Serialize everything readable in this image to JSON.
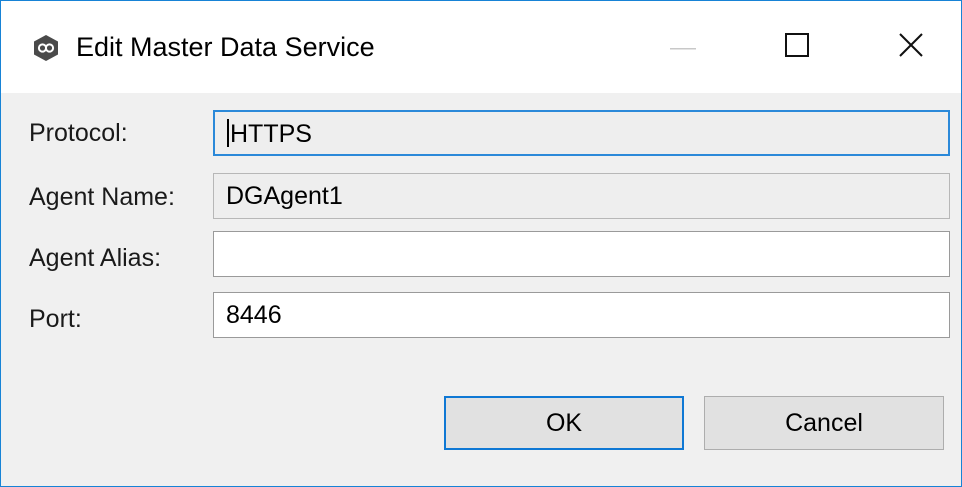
{
  "window": {
    "title": "Edit Master Data Service",
    "app_icon": "peer-logo-icon",
    "controls": {
      "minimize": "minimize-icon",
      "maximize": "maximize-icon",
      "close": "close-icon"
    }
  },
  "form": {
    "protocol": {
      "label": "Protocol:",
      "value": "HTTPS"
    },
    "agent_name": {
      "label": "Agent Name:",
      "value": "DGAgent1"
    },
    "agent_alias": {
      "label": "Agent Alias:",
      "value": ""
    },
    "port": {
      "label": "Port:",
      "value": "8446"
    }
  },
  "buttons": {
    "ok": "OK",
    "cancel": "Cancel"
  },
  "colors": {
    "accent": "#0f78d4",
    "window_border": "#1783d6",
    "dialog_bg": "#f0f0f0",
    "readonly_bg": "#eeeeee"
  }
}
